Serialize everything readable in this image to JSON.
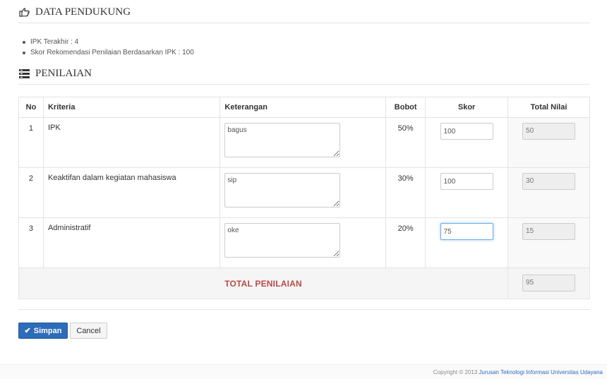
{
  "sections": {
    "data_pendukung": "DATA PENDUKUNG",
    "penilaian": "PENILAIAN"
  },
  "info": [
    "IPK Terakhir : 4",
    "Skor Rekomendasi Penilaian Berdasarkan IPK : 100"
  ],
  "table": {
    "headers": {
      "no": "No",
      "kriteria": "Kriteria",
      "keterangan": "Keterangan",
      "bobot": "Bobot",
      "skor": "Skor",
      "total": "Total Nilai"
    },
    "rows": [
      {
        "no": "1",
        "kriteria": "IPK",
        "keterangan": "bagus",
        "bobot": "50%",
        "skor": "100",
        "total": "50"
      },
      {
        "no": "2",
        "kriteria": "Keaktifan dalam kegiatan mahasiswa",
        "keterangan": "sip",
        "bobot": "30%",
        "skor": "100",
        "total": "30"
      },
      {
        "no": "3",
        "kriteria": "Administratif",
        "keterangan": "oke",
        "bobot": "20%",
        "skor": "75",
        "total": "15"
      }
    ],
    "footer_label": "TOTAL PENILAIAN",
    "footer_total": "95"
  },
  "buttons": {
    "save": "Simpan",
    "cancel": "Cancel"
  },
  "footer": {
    "copyright": "Copyright © 2013 ",
    "org": "Jurusan Teknologi Informasi Universitas Udayana"
  },
  "colors": {
    "primary": "#2d6cb8",
    "total_label": "#b94a48"
  },
  "icons": {
    "data_pendukung": "hand-point-right-icon",
    "penilaian": "list-icon",
    "save": "check-icon"
  }
}
